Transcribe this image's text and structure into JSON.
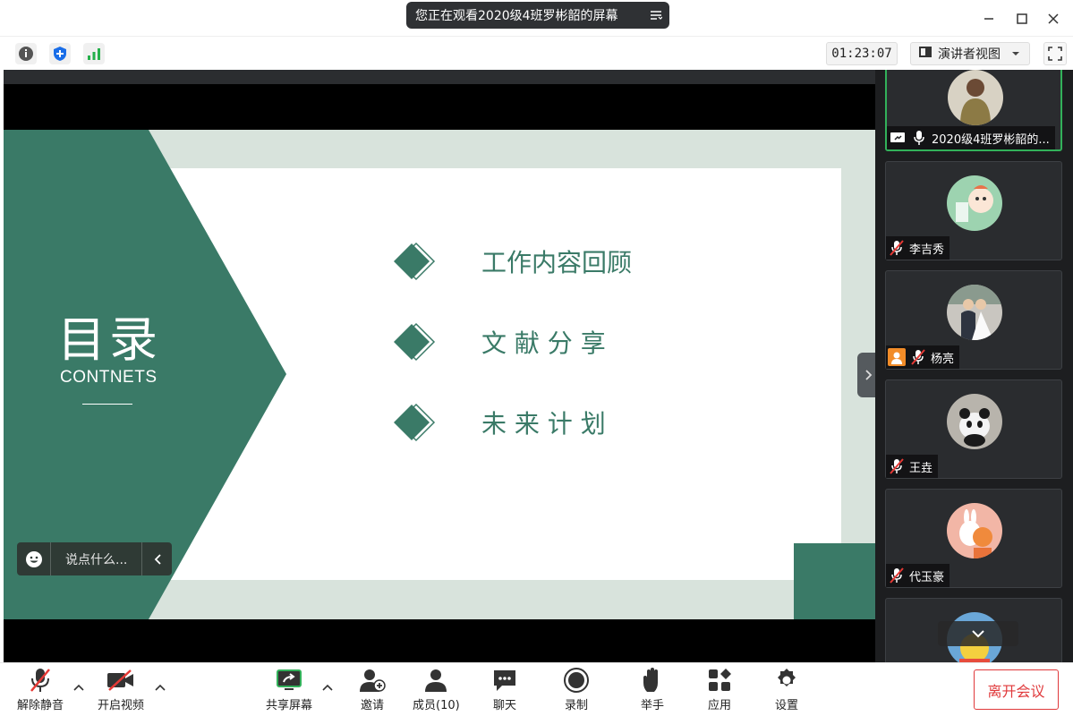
{
  "window": {
    "share_banner": "您正在观看2020级4班罗彬韶的屏幕"
  },
  "toolbar": {
    "timer": "01:23:07",
    "view_mode": "演讲者视图"
  },
  "slide": {
    "title_cn": "目录",
    "title_en": "CONTNETS",
    "items": [
      "工作内容回顾",
      "文 献 分 享",
      "未 来 计 划"
    ]
  },
  "comment": {
    "placeholder": "说点什么..."
  },
  "participants": [
    {
      "name": "2020级4班罗彬韶的..."
    },
    {
      "name": "李吉秀"
    },
    {
      "name": "杨亮"
    },
    {
      "name": "王垚"
    },
    {
      "name": "代玉豪"
    }
  ],
  "bottom": {
    "unmute": "解除静音",
    "start_video": "开启视频",
    "share_screen": "共享屏幕",
    "invite": "邀请",
    "members": "成员(10)",
    "chat": "聊天",
    "record": "录制",
    "raise_hand": "举手",
    "apps": "应用",
    "settings": "设置",
    "leave": "离开会议"
  },
  "colors": {
    "accent_green": "#3a7a67",
    "slide_bg": "#d8e3dc",
    "active_border": "#32b15a",
    "leave_red": "#e0393b"
  }
}
